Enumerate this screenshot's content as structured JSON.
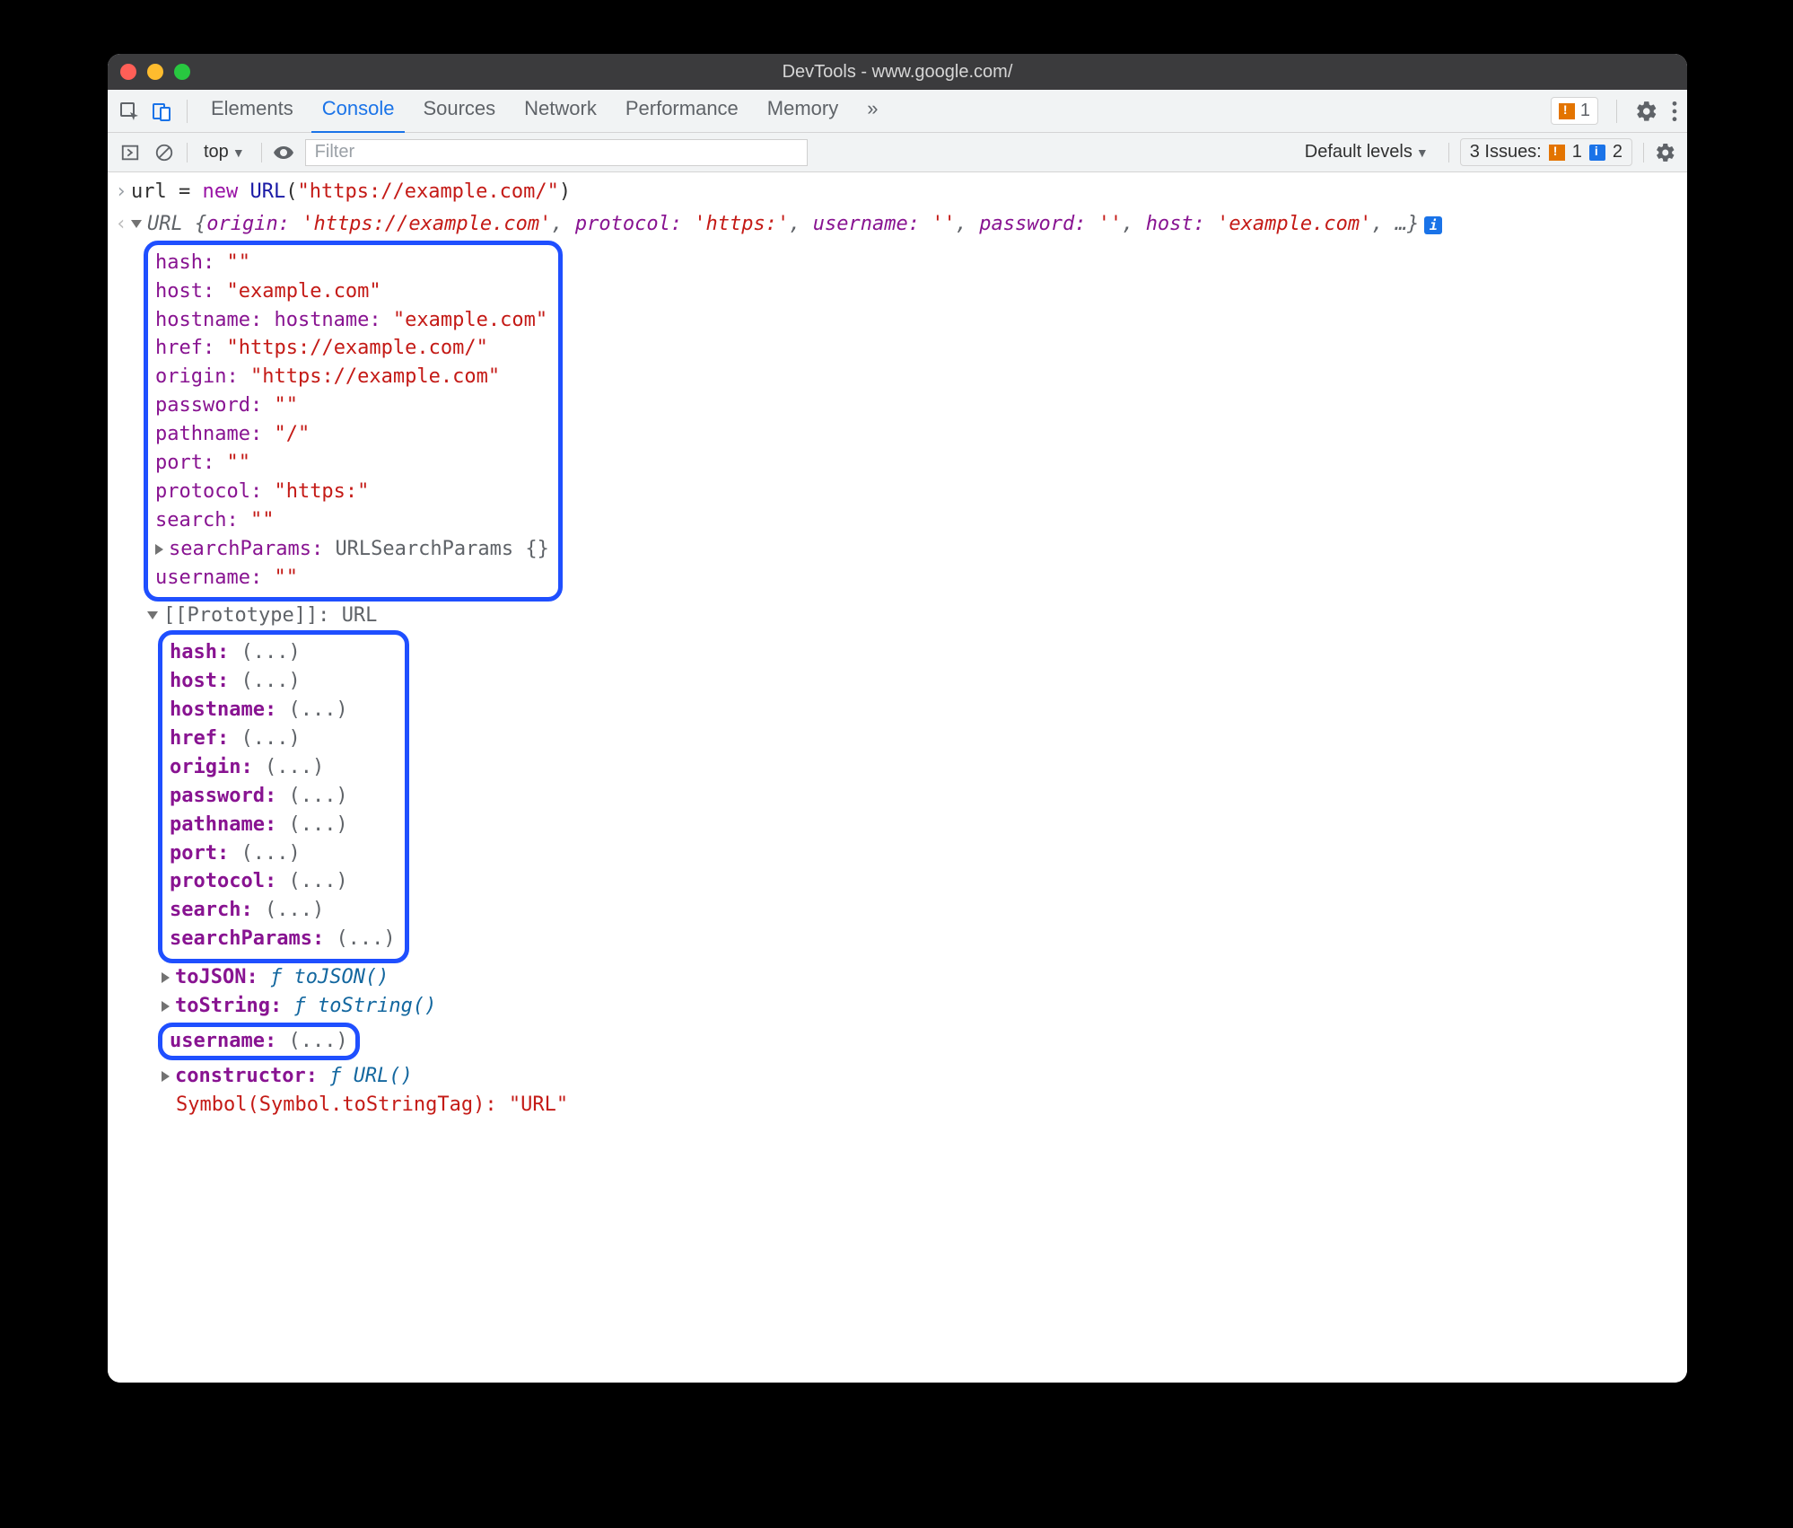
{
  "window": {
    "title": "DevTools - www.google.com/"
  },
  "tabs": {
    "elements": "Elements",
    "console": "Console",
    "sources": "Sources",
    "network": "Network",
    "performance": "Performance",
    "memory": "Memory",
    "overflow": "»"
  },
  "tabstrip": {
    "warn_count": "1"
  },
  "toolbar": {
    "context": "top",
    "filter_placeholder": "Filter",
    "levels_label": "Default levels",
    "issues_label": "3 Issues:",
    "issues_warn": "1",
    "issues_info": "2"
  },
  "console": {
    "input_line": {
      "var": "url",
      "eq": " = ",
      "newkw": "new",
      "sp": " ",
      "cls": "URL",
      "open": "(",
      "arg": "\"https://example.com/\"",
      "close": ")"
    },
    "summary": {
      "type": "URL ",
      "brace_open": "{",
      "k_origin": "origin: ",
      "v_origin": "'https://example.com'",
      "c1": ", ",
      "k_protocol": "protocol: ",
      "v_protocol": "'https:'",
      "c2": ", ",
      "k_username": "username: ",
      "v_username": "''",
      "c3": ", ",
      "k_password": "password: ",
      "v_password": "''",
      "c4": ", ",
      "k_host": "host: ",
      "v_host": "'example.com'",
      "tail": ", …}",
      "info": "i"
    },
    "props": {
      "hash": {
        "k": "hash: ",
        "v": "\"\""
      },
      "host": {
        "k": "host: ",
        "v": "\"example.com\""
      },
      "hostname": {
        "k": "hostname: ",
        "v": "\"example.com\""
      },
      "href": {
        "k": "href: ",
        "v": "\"https://example.com/\""
      },
      "origin": {
        "k": "origin: ",
        "v": "\"https://example.com\""
      },
      "password": {
        "k": "password: ",
        "v": "\"\""
      },
      "pathname": {
        "k": "pathname: ",
        "v": "\"/\""
      },
      "port": {
        "k": "port: ",
        "v": "\"\""
      },
      "protocol": {
        "k": "protocol: ",
        "v": "\"https:\""
      },
      "search": {
        "k": "search: ",
        "v": "\"\""
      },
      "searchParams": {
        "k": "searchParams: ",
        "v": "URLSearchParams {}"
      },
      "username": {
        "k": "username: ",
        "v": "\"\""
      }
    },
    "proto": {
      "label": "[[Prototype]]: ",
      "value": "URL",
      "getters": {
        "hash": "hash: ",
        "host": "host: ",
        "hostname": "hostname: ",
        "href": "href: ",
        "origin": "origin: ",
        "password": "password: ",
        "pathname": "pathname: ",
        "port": "port: ",
        "protocol": "protocol: ",
        "search": "search: ",
        "searchParams": "searchParams: "
      },
      "ellipsis": "(...)",
      "toJSON_k": "toJSON: ",
      "toJSON_v": "toJSON()",
      "toString_k": "toString: ",
      "toString_v": "toString()",
      "username": "username: ",
      "constructor_k": "constructor: ",
      "constructor_v": "URL()",
      "symline_k": "Symbol(Symbol.toStringTag): ",
      "symline_v": "\"URL\"",
      "f": "ƒ "
    }
  }
}
